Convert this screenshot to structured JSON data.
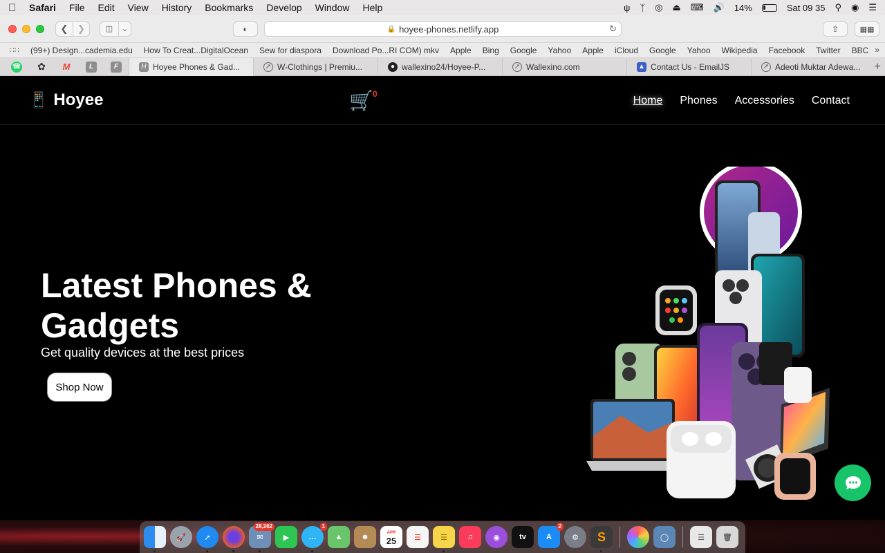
{
  "menubar": {
    "app": "Safari",
    "items": [
      "File",
      "Edit",
      "View",
      "History",
      "Bookmarks",
      "Develop",
      "Window",
      "Help"
    ],
    "battery": "14%",
    "clock": "Sat 09 35"
  },
  "browser": {
    "url": "hoyee-phones.netlify.app",
    "bookmarks": [
      "(99+) Design...cademia.edu",
      "How To Creat...DigitalOcean",
      "Sew for diaspora",
      "Download Po...RI COM) mkv",
      "Apple",
      "Bing",
      "Google",
      "Yahoo",
      "Apple",
      "iCloud",
      "Google",
      "Yahoo",
      "Wikipedia",
      "Facebook",
      "Twitter",
      "BBC"
    ],
    "pinned_tabs": [
      {
        "label": "",
        "icon": "whatsapp-icon",
        "color": "#25d366"
      },
      {
        "label": "",
        "icon": "openai-icon",
        "color": "#555555"
      },
      {
        "label": "",
        "icon": "gmail-icon",
        "color": "#ea4335"
      },
      {
        "label": "L",
        "icon": "letter-l-icon",
        "color": "#8e8e8e"
      },
      {
        "label": "F",
        "icon": "letter-f-icon",
        "color": "#8e8e8e"
      }
    ],
    "tabs": [
      {
        "label": "Hoyee Phones & Gad...",
        "fav": "H",
        "active": true
      },
      {
        "label": "W-Clothings | Premiu...",
        "fav": "",
        "active": false
      },
      {
        "label": "wallexino24/Hoyee-P...",
        "fav": "",
        "active": false
      },
      {
        "label": "Wallexino.com",
        "fav": "",
        "active": false
      },
      {
        "label": "Contact Us - EmailJS",
        "fav": "",
        "active": false
      },
      {
        "label": "Adeoti Muktar Adewa...",
        "fav": "",
        "active": false
      }
    ]
  },
  "site": {
    "logo": "Hoyee",
    "cart_count": "0",
    "nav": [
      "Home",
      "Phones",
      "Accessories",
      "Contact"
    ],
    "hero": {
      "title": "Latest Phones & Gadgets",
      "subtitle": "Get quality devices at the best prices",
      "cta": "Shop Now"
    },
    "colors": {
      "accent": "#18c46a",
      "cart_badge": "#e0382a"
    }
  },
  "dock": {
    "items": [
      {
        "name": "finder",
        "color": "#2d8cf0",
        "badge": ""
      },
      {
        "name": "launchpad",
        "color": "#9aa3ad",
        "badge": ""
      },
      {
        "name": "safari",
        "color": "#1f8af2",
        "badge": ""
      },
      {
        "name": "firefox",
        "color": "#e85d2a",
        "badge": ""
      },
      {
        "name": "mail-stamps",
        "color": "#6d8fb8",
        "badge": "28,262"
      },
      {
        "name": "facetime",
        "color": "#2dc653",
        "badge": ""
      },
      {
        "name": "messages",
        "color": "#2fb5f5",
        "badge": "1"
      },
      {
        "name": "maps",
        "color": "#6ac46a",
        "badge": ""
      },
      {
        "name": "contacts",
        "color": "#b48a55",
        "badge": ""
      },
      {
        "name": "calendar",
        "color": "#ffffff",
        "badge": ""
      },
      {
        "name": "reminders",
        "color": "#f5f5f5",
        "badge": ""
      },
      {
        "name": "notes",
        "color": "#f7d54a",
        "badge": ""
      },
      {
        "name": "music",
        "color": "#fa3c5a",
        "badge": ""
      },
      {
        "name": "podcasts",
        "color": "#9b4fdc",
        "badge": ""
      },
      {
        "name": "apple-tv",
        "color": "#111111",
        "badge": ""
      },
      {
        "name": "app-store",
        "color": "#1b8cf5",
        "badge": "2"
      },
      {
        "name": "system-preferences",
        "color": "#7a7f87",
        "badge": ""
      },
      {
        "name": "sublime-text",
        "color": "#ff9800",
        "badge": ""
      }
    ],
    "calendar_month": "APR",
    "calendar_day": "25",
    "right_items": [
      {
        "name": "photos",
        "color": "#f2f2f2"
      },
      {
        "name": "preview",
        "color": "#5b86b5"
      },
      {
        "name": "downloads-stack",
        "color": "#e8e8e8"
      },
      {
        "name": "trash",
        "color": "#d8d8d8"
      }
    ]
  }
}
